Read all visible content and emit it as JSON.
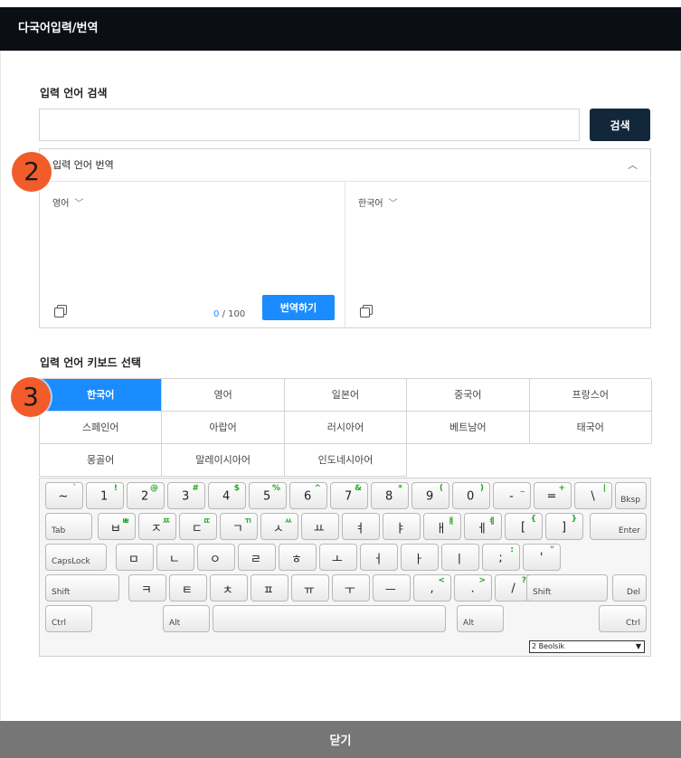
{
  "window": {
    "title": "다국어입력/번역"
  },
  "search": {
    "label": "입력 언어 검색",
    "value": "",
    "placeholder": "",
    "button": "검색"
  },
  "translate": {
    "header": "입력 언어 번역",
    "source_lang": "영어",
    "target_lang": "한국어",
    "count_current": "0",
    "count_max": "/ 100",
    "button": "번역하기"
  },
  "badges": {
    "two": "2",
    "three": "3"
  },
  "keyboard_select": {
    "label": "입력 언어 키보드 선택",
    "languages": [
      {
        "label": "한국어",
        "active": true
      },
      {
        "label": "영어"
      },
      {
        "label": "일본어"
      },
      {
        "label": "중국어"
      },
      {
        "label": "프랑스어"
      },
      {
        "label": "스페인어"
      },
      {
        "label": "아랍어"
      },
      {
        "label": "러시아어"
      },
      {
        "label": "베트남어"
      },
      {
        "label": "태국어"
      },
      {
        "label": "몽골어"
      },
      {
        "label": "말레이시아어"
      },
      {
        "label": "인도네시아어"
      }
    ]
  },
  "keyboard": {
    "rows": [
      [
        {
          "m": "~",
          "s": "`"
        },
        {
          "m": "1",
          "s": "!"
        },
        {
          "m": "2",
          "s": "@"
        },
        {
          "m": "3",
          "s": "#"
        },
        {
          "m": "4",
          "s": "$"
        },
        {
          "m": "5",
          "s": "%"
        },
        {
          "m": "6",
          "s": "^"
        },
        {
          "m": "7",
          "s": "&"
        },
        {
          "m": "8",
          "s": "*"
        },
        {
          "m": "9",
          "s": "("
        },
        {
          "m": "0",
          "s": ")"
        },
        {
          "m": "-",
          "s": "_"
        },
        {
          "m": "=",
          "s": "+"
        },
        {
          "m": "\\",
          "s": "|"
        },
        {
          "lbl": "Bksp",
          "name": "backspace"
        }
      ],
      [
        {
          "lbl": "Tab",
          "name": "tab"
        },
        {
          "m": "ㅂ",
          "s": "ㅃ"
        },
        {
          "m": "ㅈ",
          "s": "ㅉ"
        },
        {
          "m": "ㄷ",
          "s": "ㄸ"
        },
        {
          "m": "ㄱ",
          "s": "ㄲ"
        },
        {
          "m": "ㅅ",
          "s": "ㅆ"
        },
        {
          "m": "ㅛ",
          "s": ""
        },
        {
          "m": "ㅕ",
          "s": ""
        },
        {
          "m": "ㅑ",
          "s": ""
        },
        {
          "m": "ㅐ",
          "s": "ㅒ"
        },
        {
          "m": "ㅔ",
          "s": "ㅖ"
        },
        {
          "m": "[",
          "s": "{"
        },
        {
          "m": "]",
          "s": "}"
        },
        {
          "lbl": "Enter",
          "name": "enter"
        }
      ],
      [
        {
          "lbl": "CapsLock",
          "name": "capslock"
        },
        {
          "m": "ㅁ",
          "s": ""
        },
        {
          "m": "ㄴ",
          "s": ""
        },
        {
          "m": "ㅇ",
          "s": ""
        },
        {
          "m": "ㄹ",
          "s": ""
        },
        {
          "m": "ㅎ",
          "s": ""
        },
        {
          "m": "ㅗ",
          "s": ""
        },
        {
          "m": "ㅓ",
          "s": ""
        },
        {
          "m": "ㅏ",
          "s": ""
        },
        {
          "m": "ㅣ",
          "s": ""
        },
        {
          "m": ";",
          "s": ":"
        },
        {
          "m": "'",
          "s": "\""
        }
      ],
      [
        {
          "lbl": "Shift",
          "name": "shift-left"
        },
        {
          "m": "ㅋ",
          "s": ""
        },
        {
          "m": "ㅌ",
          "s": ""
        },
        {
          "m": "ㅊ",
          "s": ""
        },
        {
          "m": "ㅍ",
          "s": ""
        },
        {
          "m": "ㅠ",
          "s": ""
        },
        {
          "m": "ㅜ",
          "s": ""
        },
        {
          "m": "ㅡ",
          "s": ""
        },
        {
          "m": ",",
          "s": "<"
        },
        {
          "m": ".",
          "s": ">"
        },
        {
          "m": "/",
          "s": "?"
        },
        {
          "lbl": "Shift",
          "name": "shift-right"
        },
        {
          "lbl": "Del",
          "name": "delete"
        }
      ],
      [
        {
          "lbl": "Ctrl",
          "name": "ctrl-left"
        },
        {
          "lbl": "Alt",
          "name": "alt-left"
        },
        {
          "lbl": "",
          "name": "space"
        },
        {
          "lbl": "Alt",
          "name": "alt-right"
        },
        {
          "lbl": "Ctrl",
          "name": "ctrl-right"
        }
      ]
    ],
    "layout_select": "2 Beolsik"
  },
  "footer": {
    "close": "닫기"
  }
}
